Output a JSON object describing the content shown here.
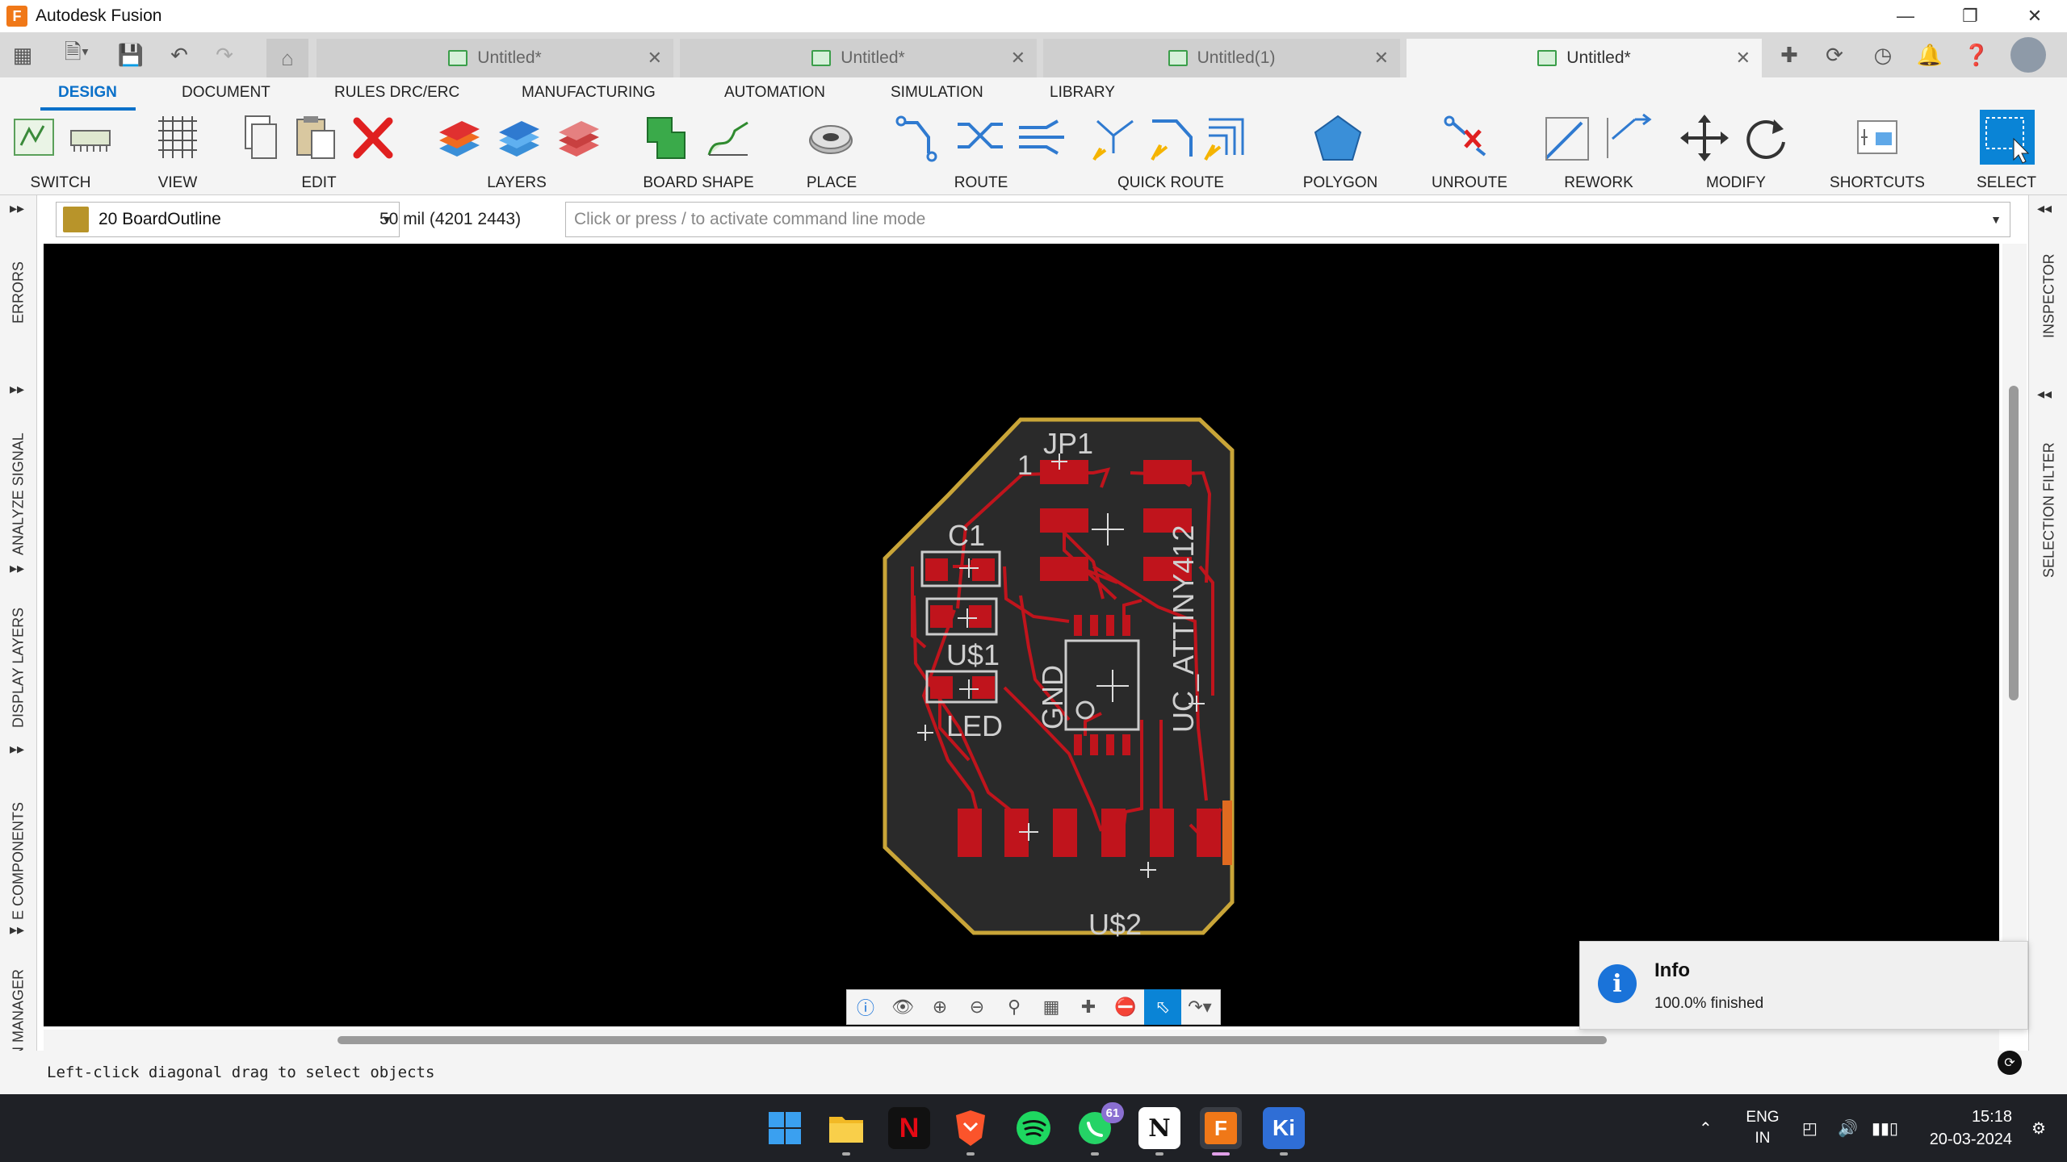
{
  "window": {
    "app_logo": "F",
    "title": "Autodesk Fusion"
  },
  "tabs": [
    {
      "label": "Untitled*",
      "active": false
    },
    {
      "label": "Untitled*",
      "active": false
    },
    {
      "label": "Untitled(1)",
      "active": false
    },
    {
      "label": "Untitled*",
      "active": true
    }
  ],
  "ribbon": {
    "tabs": [
      "DESIGN",
      "DOCUMENT",
      "RULES DRC/ERC",
      "MANUFACTURING",
      "AUTOMATION",
      "SIMULATION",
      "LIBRARY"
    ],
    "active_tab": "DESIGN",
    "groups": [
      "SWITCH",
      "VIEW",
      "EDIT",
      "LAYERS",
      "BOARD SHAPE",
      "PLACE",
      "ROUTE",
      "QUICK ROUTE",
      "POLYGON",
      "UNROUTE",
      "REWORK",
      "MODIFY",
      "SHORTCUTS",
      "SELECT"
    ]
  },
  "command_bar": {
    "layer": "20 BoardOutline",
    "layer_color": "#b8942a",
    "grid_info": "50 mil (4201 2443)",
    "command_placeholder": "Click or press / to activate command line mode"
  },
  "left_panels": [
    "ERRORS",
    "ANALYZE SIGNAL",
    "DISPLAY LAYERS",
    "E COMPONENTS",
    "ESIGN MANAGER"
  ],
  "right_panels": [
    "INSPECTOR",
    "SELECTION FILTER"
  ],
  "pcb": {
    "labels": {
      "jp1": "JP1",
      "pin1": "1",
      "c1": "C1",
      "us1": "U$1",
      "led": "LED",
      "gnd": "GND",
      "uc": "UC_ATTINY412",
      "us2": "U$2"
    },
    "board_color": "#2a2a2a",
    "outline_color": "#c9a538",
    "copper_color": "#c0141c"
  },
  "toast": {
    "title": "Info",
    "message": "100.0% finished"
  },
  "status": {
    "text": "Left-click diagonal drag to select objects"
  },
  "taskbar": {
    "whatsapp_badge": "61",
    "fusion_letter": "F",
    "kicad_letters": "Ki",
    "notion_letter": "N",
    "language": "ENG",
    "region": "IN",
    "time": "15:18",
    "date": "20-03-2024"
  }
}
